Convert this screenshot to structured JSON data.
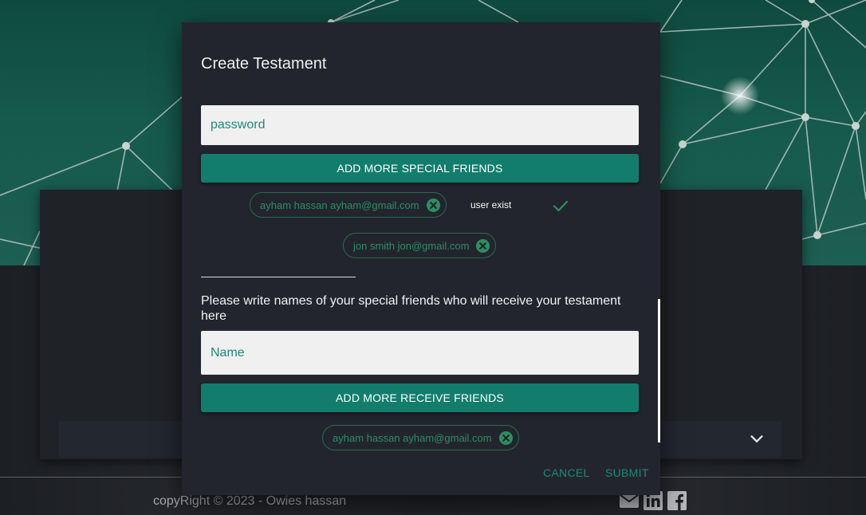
{
  "modal": {
    "title": "Create Testament",
    "password_placeholder": "password",
    "add_special_label": "ADD MORE SPECIAL FRIENDS",
    "special_friends": [
      {
        "label": "ayham hassan ayham@gmail.com"
      },
      {
        "label": "jon smith jon@gmail.com"
      }
    ],
    "user_status": "user exist",
    "instruction": "Please write names of your special friends who will receive your testament here",
    "name_placeholder": "Name",
    "add_receive_label": "ADD MORE RECEIVE FRIENDS",
    "receive_friends": [
      {
        "label": "ayham hassan ayham@gmail.com"
      }
    ],
    "cancel_label": "CANCEL",
    "submit_label": "SUBMIT"
  },
  "footer": {
    "copyright": "copyRight © 2023 - Owies hassan",
    "social_icons": [
      "mail-icon",
      "linkedin-icon",
      "facebook-icon"
    ]
  },
  "colors": {
    "accent": "#127d6d",
    "chip_text": "#2d8e60",
    "modal_bg": "#22252e",
    "hero_bg": "#155a4b"
  }
}
